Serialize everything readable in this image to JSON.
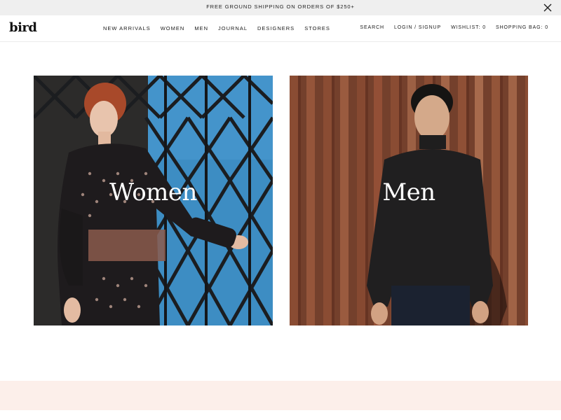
{
  "promo": {
    "text": "FREE GROUND SHIPPING ON ORDERS OF $250+",
    "close_icon": "close-icon"
  },
  "header": {
    "logo": "bird",
    "nav": [
      "NEW ARRIVALS",
      "WOMEN",
      "MEN",
      "JOURNAL",
      "DESIGNERS",
      "STORES"
    ],
    "utility": [
      "SEARCH",
      "LOGIN / SIGNUP",
      "WISHLIST: 0",
      "SHOPPING BAG: 0"
    ]
  },
  "tiles": {
    "women": {
      "label": "Women"
    },
    "men": {
      "label": "Men"
    }
  },
  "colors": {
    "promo_bg": "#efefef",
    "band_bg": "#fcefea",
    "women_wall": "#3f8fc4",
    "men_wall": "#7a3a26"
  }
}
